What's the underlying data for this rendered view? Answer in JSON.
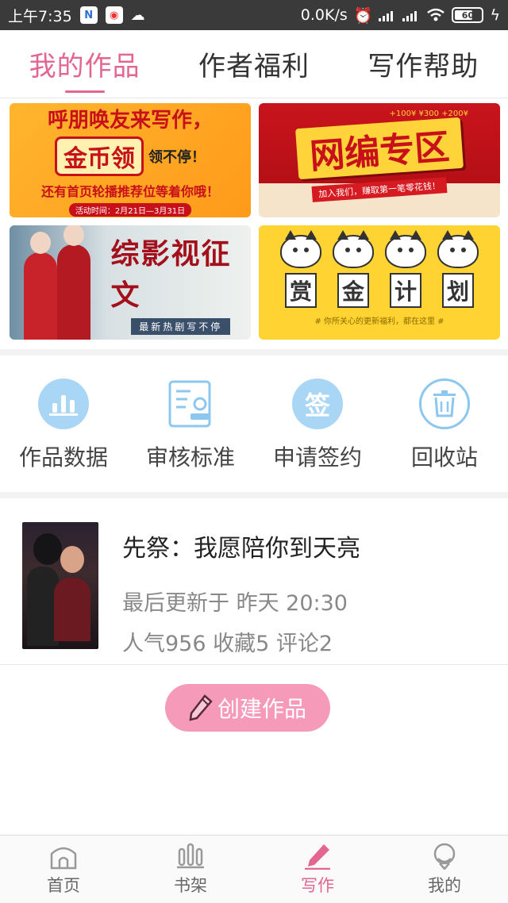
{
  "status_bar": {
    "time": "上午7:35",
    "network_speed": "0.0K/s",
    "battery": "60",
    "icons": [
      "n-app-icon",
      "q-app-icon",
      "cloud-icon",
      "alarm-icon",
      "signal-icon",
      "signal-icon",
      "wifi-icon",
      "battery-icon",
      "charging-icon"
    ]
  },
  "tabs": [
    {
      "label": "我的作品",
      "active": true
    },
    {
      "label": "作者福利",
      "active": false
    },
    {
      "label": "写作帮助",
      "active": false
    }
  ],
  "banners": {
    "invite": {
      "line1": "呼朋唤友来写作，",
      "coin": "金币领",
      "line2": "领不停！",
      "line3": "还有首页轮播推荐位等着你哦！",
      "line4": "活动时间：2月21日—3月31日"
    },
    "editor": {
      "title": "网编专区",
      "subtitle": "加入我们，赚取第一笔零花钱！",
      "money": "+100¥ ¥300 +200¥"
    },
    "contest": {
      "title": "综影视征文",
      "subtitle": "最新热剧写不停"
    },
    "bounty": {
      "chars": [
        "赏",
        "金",
        "计",
        "划"
      ],
      "footer": "# 你所关心的更新福利，都在这里 #"
    }
  },
  "quick_actions": [
    {
      "label": "作品数据",
      "icon": "bar-chart-icon"
    },
    {
      "label": "审核标准",
      "icon": "document-stamp-icon"
    },
    {
      "label": "申请签约",
      "icon": "sign-icon",
      "glyph": "签"
    },
    {
      "label": "回收站",
      "icon": "trash-icon"
    }
  ],
  "work": {
    "title": "先祭：我愿陪你到天亮",
    "updated": "最后更新于 昨天 20:30",
    "stats": "人气956 收藏5 评论2"
  },
  "create_button": {
    "label": "创建作品",
    "icon": "pencil-icon"
  },
  "bottom_nav": [
    {
      "label": "首页",
      "icon": "home-icon",
      "active": false
    },
    {
      "label": "书架",
      "icon": "bookshelf-icon",
      "active": false
    },
    {
      "label": "写作",
      "icon": "write-icon",
      "active": true
    },
    {
      "label": "我的",
      "icon": "profile-icon",
      "active": false
    }
  ],
  "colors": {
    "accent": "#e36690",
    "create_button": "#f59ab9",
    "quick_icon": "#9fd2f3",
    "status_bar": "#3a3a3a"
  }
}
